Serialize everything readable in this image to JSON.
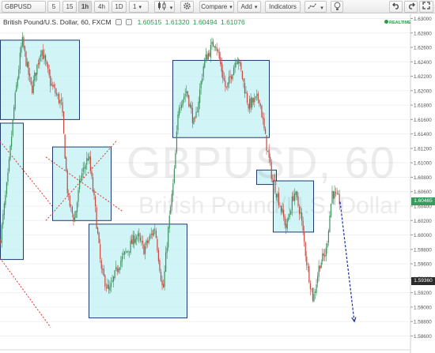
{
  "toolbar": {
    "symbol": "GBPUSD",
    "intervals": [
      "5",
      "15",
      "1h",
      "4h",
      "1D",
      "1"
    ],
    "active_interval": "1h",
    "compare_label": "Compare",
    "add_label": "Add",
    "indicators_label": "Indicators"
  },
  "legend": {
    "title": "British Pound/U.S. Dollar, 60, FXCM",
    "open": "1.60515",
    "high": "1.61320",
    "low": "1.60494",
    "close": "1.61076"
  },
  "realtime_label": "REALTIME",
  "watermark": {
    "line1": "GBPUSD, 60",
    "line2": "British Pound/U.S. Dollar"
  },
  "price_axis": {
    "labels": [
      "1.63000",
      "1.62800",
      "1.62600",
      "1.62400",
      "1.62200",
      "1.62000",
      "1.61800",
      "1.61600",
      "1.61400",
      "1.61200",
      "1.61000",
      "1.60800",
      "1.60600",
      "1.60400",
      "1.60200",
      "1.60000",
      "1.59800",
      "1.59600",
      "1.59400",
      "1.59200",
      "1.59000",
      "1.58800",
      "1.58600"
    ],
    "last_price": "1.60465",
    "marker_price": "1.59360"
  },
  "colors": {
    "up": "#3a8f5a",
    "down": "#c7473f",
    "box_fill": "#c6f1f5",
    "box_stroke": "#1f3a6e",
    "trend_line": "#e0352b",
    "arrow": "#1a2fb0",
    "last_price_bg": "#3a9a5d",
    "marker_bg": "#2b2b2b"
  },
  "chart_data": {
    "type": "candlestick",
    "symbol": "GBPUSD",
    "interval": "60",
    "ylim": [
      1.5855,
      1.6306
    ],
    "candle_count": 280,
    "anchors": [
      [
        0,
        1.599
      ],
      [
        10,
        1.608
      ],
      [
        18,
        1.618
      ],
      [
        28,
        1.627
      ],
      [
        40,
        1.62
      ],
      [
        52,
        1.626
      ],
      [
        64,
        1.621
      ],
      [
        78,
        1.618
      ],
      [
        86,
        1.605
      ],
      [
        94,
        1.602
      ],
      [
        102,
        1.608
      ],
      [
        112,
        1.611
      ],
      [
        120,
        1.604
      ],
      [
        128,
        1.595
      ],
      [
        138,
        1.592
      ],
      [
        150,
        1.596
      ],
      [
        162,
        1.598
      ],
      [
        172,
        1.6
      ],
      [
        182,
        1.598
      ],
      [
        196,
        1.601
      ],
      [
        206,
        1.592
      ],
      [
        212,
        1.6
      ],
      [
        220,
        1.608
      ],
      [
        226,
        1.618
      ],
      [
        236,
        1.62
      ],
      [
        246,
        1.615
      ],
      [
        258,
        1.624
      ],
      [
        272,
        1.627
      ],
      [
        286,
        1.62
      ],
      [
        300,
        1.625
      ],
      [
        314,
        1.618
      ],
      [
        328,
        1.619
      ],
      [
        336,
        1.613
      ],
      [
        344,
        1.608
      ],
      [
        352,
        1.605
      ],
      [
        362,
        1.601
      ],
      [
        372,
        1.606
      ],
      [
        380,
        1.603
      ],
      [
        388,
        1.596
      ],
      [
        396,
        1.591
      ],
      [
        404,
        1.596
      ],
      [
        412,
        1.5975
      ],
      [
        420,
        1.606
      ],
      [
        426,
        1.605
      ],
      [
        430,
        1.6046
      ]
    ],
    "rectangles": [
      {
        "x1": 0,
        "x2": 100,
        "p1": 1.627,
        "p2": 1.616
      },
      {
        "x1": 0,
        "x2": 29,
        "p1": 1.6155,
        "p2": 1.5966
      },
      {
        "x1": 66,
        "x2": 140,
        "p1": 1.6122,
        "p2": 1.602
      },
      {
        "x1": 112,
        "x2": 236,
        "p1": 1.6015,
        "p2": 1.5885
      },
      {
        "x1": 218,
        "x2": 340,
        "p1": 1.6242,
        "p2": 1.6135
      },
      {
        "x1": 324,
        "x2": 349,
        "p1": 1.609,
        "p2": 1.607
      },
      {
        "x1": 345,
        "x2": 396,
        "p1": 1.6075,
        "p2": 1.6004
      }
    ],
    "trend_lines": [
      {
        "x1": 0,
        "p1": 1.613,
        "x2": 66,
        "p2": 1.604
      },
      {
        "x1": 58,
        "p1": 1.6108,
        "x2": 156,
        "p2": 1.6032
      },
      {
        "x1": 58,
        "p1": 1.602,
        "x2": 147,
        "p2": 1.613
      },
      {
        "x1": 0,
        "p1": 1.5968,
        "x2": 64,
        "p2": 1.5872
      }
    ],
    "projection": {
      "x1": 430,
      "p1": 1.6046,
      "x2": 448,
      "p2": 1.588
    }
  }
}
